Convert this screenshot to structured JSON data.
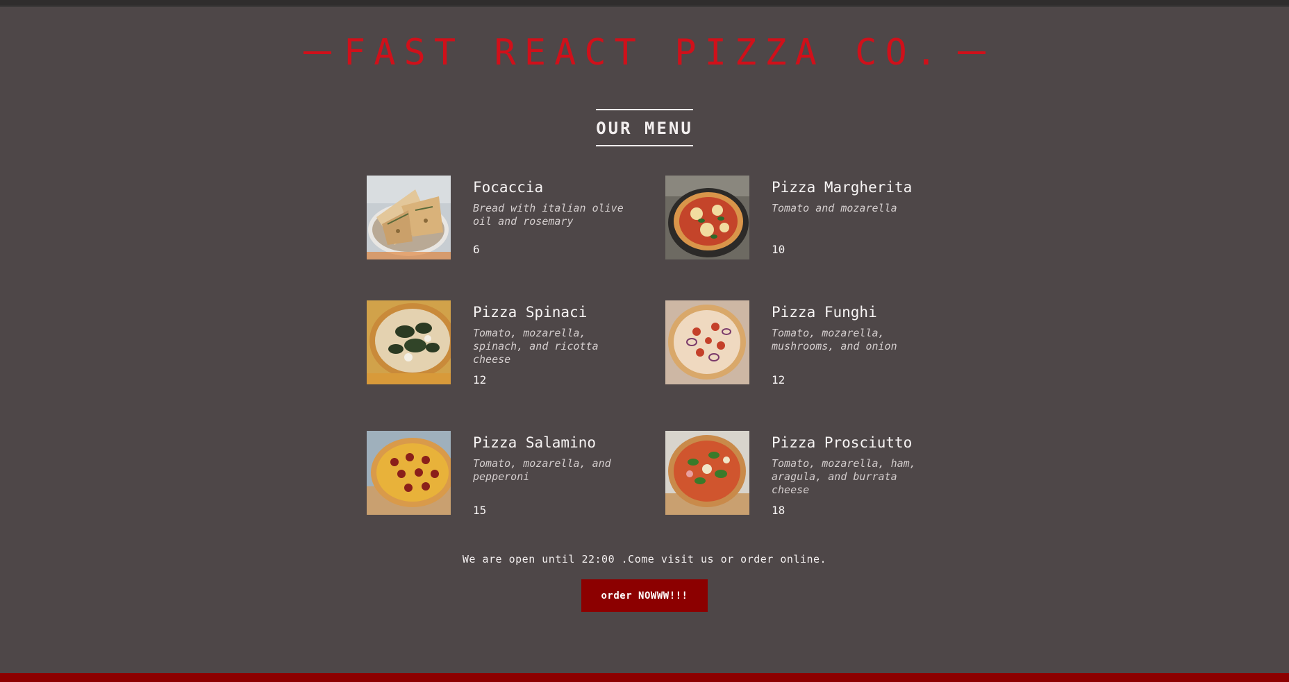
{
  "header": {
    "title": "Fast React Pizza Co."
  },
  "menu": {
    "heading": "Our Menu",
    "pizzas": [
      {
        "name": "Focaccia",
        "ingredients": "Bread with italian olive oil and rosemary",
        "price": "6",
        "image": "focaccia-photo"
      },
      {
        "name": "Pizza Margherita",
        "ingredients": "Tomato and mozarella",
        "price": "10",
        "image": "margherita-photo"
      },
      {
        "name": "Pizza Spinaci",
        "ingredients": "Tomato, mozarella, spinach, and ricotta cheese",
        "price": "12",
        "image": "spinaci-photo"
      },
      {
        "name": "Pizza Funghi",
        "ingredients": "Tomato, mozarella, mushrooms, and onion",
        "price": "12",
        "image": "funghi-photo"
      },
      {
        "name": "Pizza Salamino",
        "ingredients": "Tomato, mozarella, and pepperoni",
        "price": "15",
        "image": "salamino-photo"
      },
      {
        "name": "Pizza Prosciutto",
        "ingredients": "Tomato, mozarella, ham, aragula, and burrata cheese",
        "price": "18",
        "image": "prosciutto-photo"
      }
    ]
  },
  "footer": {
    "text": "We are open until 22:00 .Come visit us or order online.",
    "order_button": "order NOWWW!!!"
  },
  "colors": {
    "background": "#4e4748",
    "brand_red": "#d0101a",
    "button_red": "#8c0000",
    "text": "#f2eeee"
  }
}
